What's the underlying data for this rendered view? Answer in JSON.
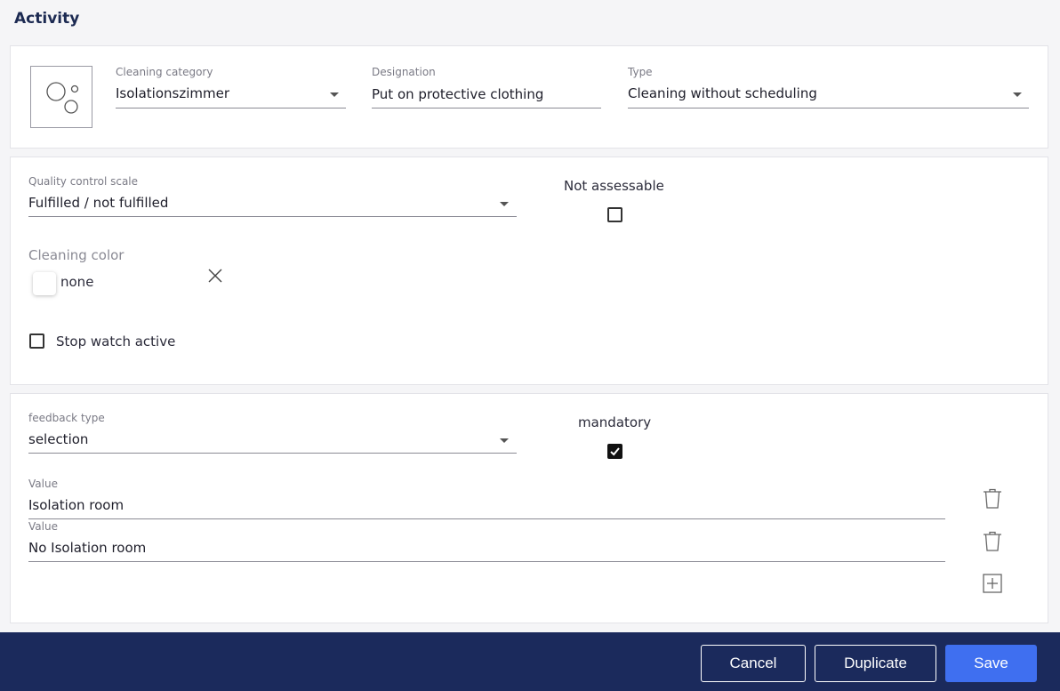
{
  "page": {
    "title": "Activity"
  },
  "general": {
    "category_icon": "bubbles-icon",
    "cleaning_category": {
      "label": "Cleaning category",
      "value": "Isolationszimmer"
    },
    "designation": {
      "label": "Designation",
      "value": "Put on protective clothing"
    },
    "type": {
      "label": "Type",
      "value": "Cleaning without scheduling"
    }
  },
  "quality": {
    "scale": {
      "label": "Quality control scale",
      "value": "Fulfilled / not fulfilled"
    },
    "not_assessable": {
      "label": "Not assessable",
      "checked": false
    },
    "cleaning_color": {
      "label": "Cleaning color",
      "value": "none",
      "swatch": "#ffffff"
    },
    "stop_watch": {
      "label": "Stop watch active",
      "checked": false
    }
  },
  "feedback": {
    "type": {
      "label": "feedback type",
      "value": "selection"
    },
    "mandatory": {
      "label": "mandatory",
      "checked": true
    },
    "values": [
      {
        "label": "Value",
        "value": "Isolation room"
      },
      {
        "label": "Value",
        "value": "No Isolation room"
      }
    ]
  },
  "footer": {
    "cancel_label": "Cancel",
    "duplicate_label": "Duplicate",
    "save_label": "Save",
    "accent_color": "#3f6ff0",
    "bar_color": "#1b2a5c"
  }
}
